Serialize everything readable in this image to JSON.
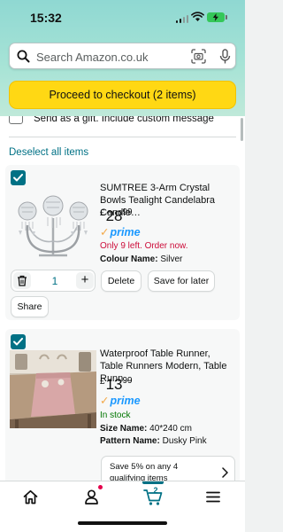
{
  "status_bar": {
    "time": "15:32"
  },
  "search": {
    "placeholder": "Search Amazon.co.uk"
  },
  "checkout": {
    "label": "Proceed to checkout (2 items)"
  },
  "gift": {
    "label": "Send as a gift. Include custom message"
  },
  "deselect_label": "Deselect all items",
  "items": [
    {
      "title": "SUMTREE 3-Arm Crystal Bowls Tealight Candelabra Candle…",
      "currency": "£",
      "price_whole": "28",
      "price_fraction": "99",
      "prime": "prime",
      "stock": "Only 9 left. Order now.",
      "attributes": [
        {
          "name": "Colour Name:",
          "value": "Silver"
        }
      ],
      "quantity": "1",
      "delete_label": "Delete",
      "save_label": "Save for later",
      "share_label": "Share"
    },
    {
      "title": "Waterproof Table Runner, Table Runners Modern, Table Runn…",
      "currency": "£",
      "price_whole": "13",
      "price_fraction": "99",
      "prime": "prime",
      "stock": "In stock",
      "attributes": [
        {
          "name": "Size Name:",
          "value": "40*240 cm"
        },
        {
          "name": "Pattern Name:",
          "value": "Dusky Pink"
        }
      ],
      "promo": "Save 5% on any 4 qualifying items"
    }
  ],
  "tabbar": {
    "cart_count": "2",
    "tabs": [
      "home-icon",
      "account-icon",
      "cart-icon",
      "menu-icon"
    ]
  },
  "colors": {
    "header_teal": "#a6e3d6",
    "checkout_yellow": "#ffd814",
    "link_teal": "#007185",
    "prime_blue": "#1a98ff",
    "low_stock_red": "#cc0c39",
    "in_stock_green": "#007600"
  }
}
